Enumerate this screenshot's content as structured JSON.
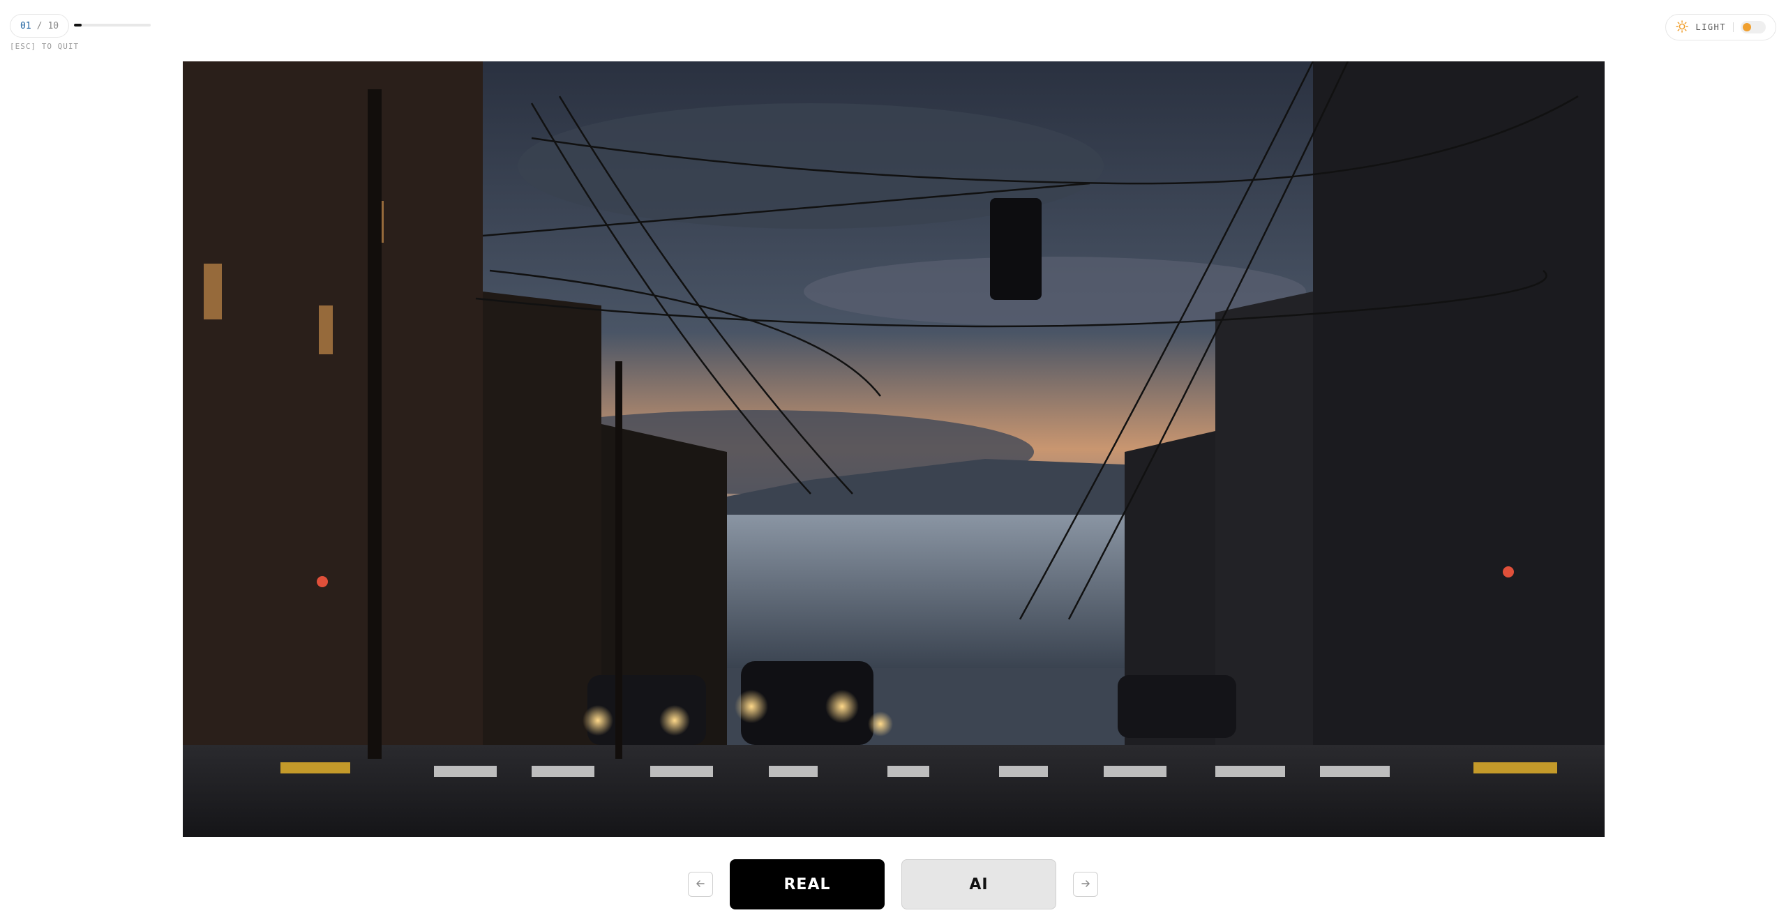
{
  "counter": {
    "current": "01",
    "separator": "/",
    "total": "10",
    "progress": 0.1
  },
  "hint": {
    "quit": "[ESC] TO QUIT"
  },
  "theme": {
    "label": "LIGHT",
    "icon": "sun-icon",
    "accent": "#f0a030"
  },
  "photo": {
    "alt": ""
  },
  "controls": {
    "prev_icon": "arrow-left-icon",
    "next_icon": "arrow-right-icon",
    "real_label": "REAL",
    "ai_label": "AI"
  }
}
